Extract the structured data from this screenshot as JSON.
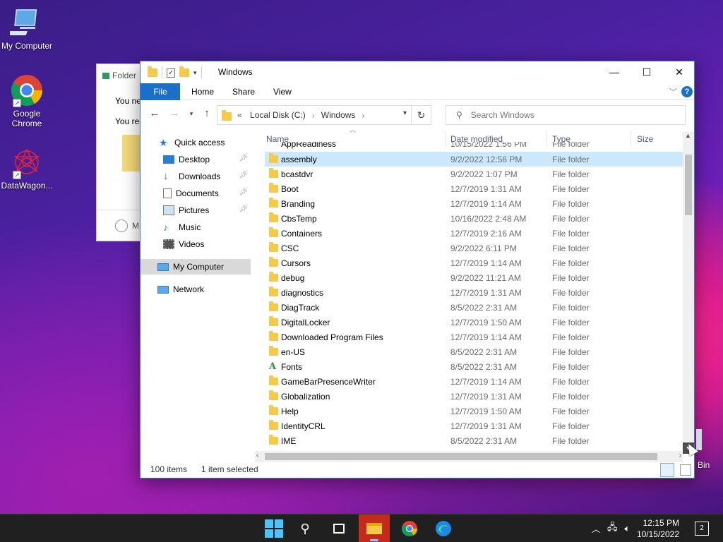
{
  "desktop": {
    "icons": [
      {
        "label": "My Computer"
      },
      {
        "label": "Google Chrome"
      },
      {
        "label": "DataWagon..."
      }
    ],
    "recycle_label": "Bin"
  },
  "bg_dialog": {
    "title": "Folder",
    "line1": "You ne",
    "line2": "You rec",
    "footer": "M"
  },
  "explorer": {
    "title": "Windows",
    "ribbon_tabs": [
      "File",
      "Home",
      "Share",
      "View"
    ],
    "breadcrumb": [
      "Local Disk (C:)",
      "Windows"
    ],
    "breadcrumb_prefix": "«",
    "search_placeholder": "Search Windows",
    "nav": {
      "quick_access": "Quick access",
      "pinned": [
        "Desktop",
        "Downloads",
        "Documents",
        "Pictures"
      ],
      "unpinned": [
        "Music",
        "Videos"
      ],
      "my_computer": "My Computer",
      "network": "Network"
    },
    "columns": [
      "Name",
      "Date modified",
      "Type",
      "Size"
    ],
    "partial_row": {
      "name": "AppReadiness",
      "date": "10/15/2022 1:56 PM",
      "type": "File folder"
    },
    "files": [
      {
        "name": "assembly",
        "date": "9/2/2022 12:56 PM",
        "type": "File folder",
        "selected": true
      },
      {
        "name": "bcastdvr",
        "date": "9/2/2022 1:07 PM",
        "type": "File folder"
      },
      {
        "name": "Boot",
        "date": "12/7/2019 1:31 AM",
        "type": "File folder"
      },
      {
        "name": "Branding",
        "date": "12/7/2019 1:14 AM",
        "type": "File folder"
      },
      {
        "name": "CbsTemp",
        "date": "10/16/2022 2:48 AM",
        "type": "File folder"
      },
      {
        "name": "Containers",
        "date": "12/7/2019 2:16 AM",
        "type": "File folder"
      },
      {
        "name": "CSC",
        "date": "9/2/2022 6:11 PM",
        "type": "File folder"
      },
      {
        "name": "Cursors",
        "date": "12/7/2019 1:14 AM",
        "type": "File folder"
      },
      {
        "name": "debug",
        "date": "9/2/2022 11:21 AM",
        "type": "File folder"
      },
      {
        "name": "diagnostics",
        "date": "12/7/2019 1:31 AM",
        "type": "File folder"
      },
      {
        "name": "DiagTrack",
        "date": "8/5/2022 2:31 AM",
        "type": "File folder"
      },
      {
        "name": "DigitalLocker",
        "date": "12/7/2019 1:50 AM",
        "type": "File folder"
      },
      {
        "name": "Downloaded Program Files",
        "date": "12/7/2019 1:14 AM",
        "type": "File folder"
      },
      {
        "name": "en-US",
        "date": "8/5/2022 2:31 AM",
        "type": "File folder"
      },
      {
        "name": "Fonts",
        "date": "8/5/2022 2:31 AM",
        "type": "File folder",
        "icon": "fonts"
      },
      {
        "name": "GameBarPresenceWriter",
        "date": "12/7/2019 1:14 AM",
        "type": "File folder"
      },
      {
        "name": "Globalization",
        "date": "12/7/2019 1:31 AM",
        "type": "File folder"
      },
      {
        "name": "Help",
        "date": "12/7/2019 1:50 AM",
        "type": "File folder"
      },
      {
        "name": "IdentityCRL",
        "date": "12/7/2019 1:31 AM",
        "type": "File folder"
      },
      {
        "name": "IME",
        "date": "8/5/2022 2:31 AM",
        "type": "File folder"
      }
    ],
    "status": {
      "items": "100 items",
      "selected": "1 item selected"
    }
  },
  "taskbar": {
    "time": "12:15 PM",
    "date": "10/15/2022",
    "notifications": "2"
  },
  "colors": {
    "accent": "#1a6fc8",
    "selection": "#cce8ff",
    "folder": "#f7c948",
    "taskbar": "#202020"
  }
}
